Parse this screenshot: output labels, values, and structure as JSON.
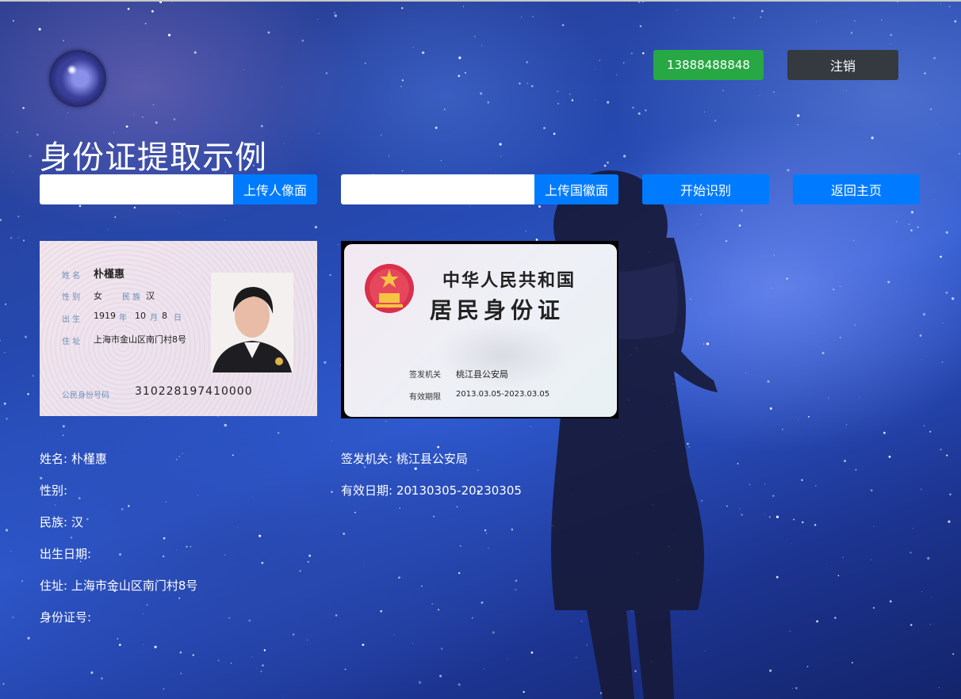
{
  "header": {
    "phone_label": "13888488848",
    "logout_label": "注销"
  },
  "page": {
    "title": "身份证提取示例"
  },
  "toolbar": {
    "portrait_input_value": "",
    "upload_portrait_label": "上传人像面",
    "emblem_input_value": "",
    "upload_emblem_label": "上传国徽面",
    "start_label": "开始识别",
    "home_label": "返回主页"
  },
  "card_front": {
    "name_label": "姓 名",
    "name": "朴槿惠",
    "sex_label": "性 别",
    "sex": "女",
    "ethnicity_label": "民 族",
    "ethnicity": "汉",
    "birth_label": "出 生",
    "birth_year": "1919",
    "year_unit": "年",
    "birth_month": "10",
    "month_unit": "月",
    "birth_day": "8",
    "day_unit": "日",
    "address_label": "住 址",
    "address": "上海市金山区南门村8号",
    "id_label": "公民身份号码",
    "id_number": "310228197410000"
  },
  "card_back": {
    "country": "中华人民共和国",
    "title": "居民身份证",
    "authority_label": "签发机关",
    "authority": "桃江县公安局",
    "validity_label": "有效期限",
    "validity": "2013.03.05-2023.03.05"
  },
  "results": {
    "name_line": "姓名: 朴槿惠",
    "sex_line": "性别:",
    "ethnicity_line": "民族: 汉",
    "birth_line": "出生日期:",
    "address_line": "住址: 上海市金山区南门村8号",
    "id_line": "身份证号:",
    "authority_line": "签发机关: 桃江县公安局",
    "validity_line": "有效日期: 20130305-20230305"
  },
  "colors": {
    "phone_button": "#28a745",
    "logout_button": "#343a40",
    "primary_button": "#007bff",
    "text": "#ffffff"
  },
  "icons": {
    "avatar": "galaxy-avatar",
    "emblem": "national-emblem"
  }
}
